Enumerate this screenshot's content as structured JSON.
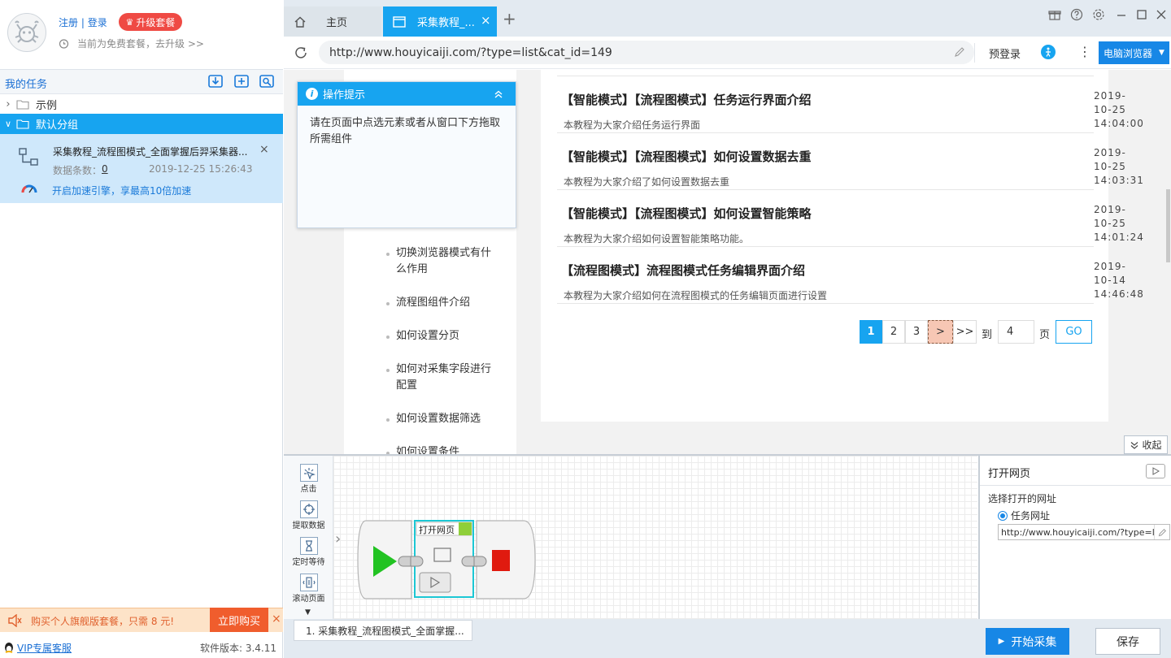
{
  "user": {
    "register": "注册",
    "separator": "|",
    "login": "登录",
    "upgrade": "升级套餐",
    "free_note": "当前为免费套餐，去升级 >>"
  },
  "tasks": {
    "title": "我的任务",
    "groups": [
      {
        "label": "示例",
        "expanded": false
      },
      {
        "label": "默认分组",
        "expanded": true
      }
    ],
    "item": {
      "name": "采集教程_流程图模式_全面掌握后羿采集器...",
      "count_label": "数据条数：",
      "count": "0",
      "time": "2019-12-25 15:26:43",
      "boost": "开启加速引擎，享最高10倍加速"
    }
  },
  "promo": {
    "text": "购买个人旗舰版套餐，只需 8 元!",
    "buy": "立即购买",
    "close": "×"
  },
  "footer": {
    "vip": "VIP专属客服",
    "version": "软件版本: 3.4.11"
  },
  "tabs": {
    "home": "主页",
    "active": "采集教程_...",
    "close": "×",
    "add": "+"
  },
  "address": {
    "url": "http://www.houyicaiji.com/?type=list&cat_id=149",
    "prelogin": "预登录",
    "browser_mode": "电脑浏览器"
  },
  "tips": {
    "title": "操作提示",
    "body": "请在页面中点选元素或者从窗口下方拖取所需组件"
  },
  "nav": [
    "切换浏览器模式有什么作用",
    "流程图组件介绍",
    "如何设置分页",
    "如何对采集字段进行配置",
    "如何设置数据筛选",
    "如何设置条件"
  ],
  "articles": [
    {
      "title": "【智能模式】【流程图模式】任务运行界面介绍",
      "desc": "本教程为大家介绍任务运行界面",
      "date": [
        "2019-",
        "10-25",
        "14:04:00"
      ]
    },
    {
      "title": "【智能模式】【流程图模式】如何设置数据去重",
      "desc": "本教程为大家介绍了如何设置数据去重",
      "date": [
        "2019-",
        "10-25",
        "14:03:31"
      ]
    },
    {
      "title": "【智能模式】【流程图模式】如何设置智能策略",
      "desc": "本教程为大家介绍如何设置智能策略功能。",
      "date": [
        "2019-",
        "10-25",
        "14:01:24"
      ]
    },
    {
      "title": "【流程图模式】流程图模式任务编辑界面介绍",
      "desc": "本教程为大家介绍如何在流程图模式的任务编辑页面进行设置",
      "date": [
        "2019-",
        "10-14",
        "14:46:48"
      ]
    }
  ],
  "pagination": {
    "pages": [
      "1",
      "2",
      "3"
    ],
    "current": "1",
    "next": ">",
    "last": ">>",
    "to": "到",
    "page_input": "4",
    "page_unit": "页",
    "go": "GO"
  },
  "collapse": "收起",
  "palette": [
    "点击",
    "提取数据",
    "定时等待",
    "滚动页面"
  ],
  "flow": {
    "node_label": "打开网页"
  },
  "props": {
    "title": "打开网页",
    "section": "选择打开的网址",
    "option": "任务网址",
    "url": "http://www.houyicaiji.com/?type=li"
  },
  "bottom": {
    "flow_tab": "1. 采集教程_流程图模式_全面掌握...",
    "start": "开始采集",
    "save": "保存"
  },
  "colors": {
    "accent": "#17a4f0",
    "primary_button": "#1787e6",
    "upgrade": "#ef4a44",
    "buy": "#f05d2d",
    "selected_group": "#17a4f0",
    "selected_task": "#cfe8fb",
    "start_node": "#22c322",
    "stop_node": "#e01a0f"
  }
}
